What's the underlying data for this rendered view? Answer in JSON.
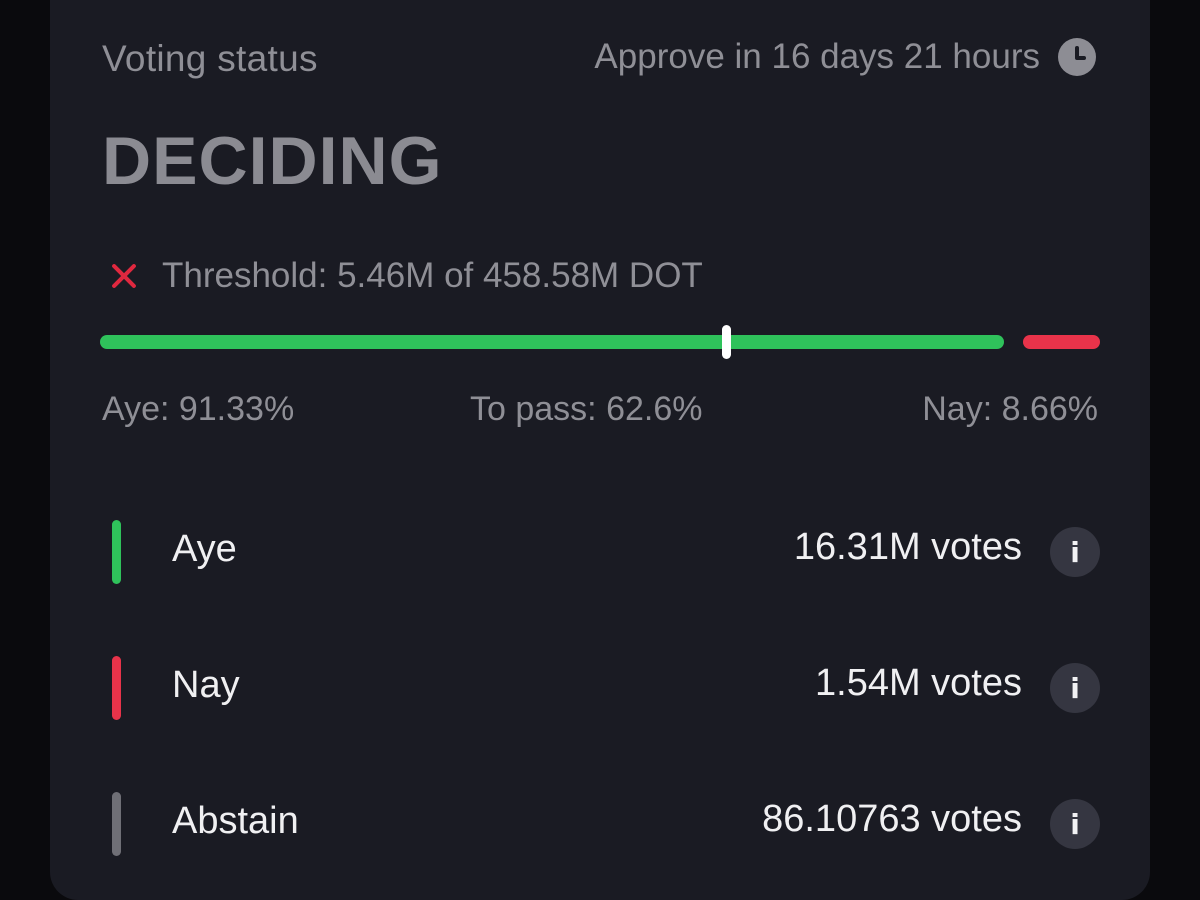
{
  "header": {
    "title": "Voting status",
    "approve_text": "Approve in 16 days 21 hours",
    "clock_icon": "clock-icon"
  },
  "status": "DECIDING",
  "threshold": {
    "text": "Threshold: 5.46M of 458.58M DOT",
    "icon": "x-icon",
    "met": false
  },
  "progress": {
    "aye_fraction": 0.9133,
    "nay_fraction": 0.0866,
    "pass_fraction": 0.626,
    "aye_label": "Aye: 91.33%",
    "pass_label": "To pass: 62.6%",
    "nay_label": "Nay: 8.66%"
  },
  "votes": [
    {
      "label": "Aye",
      "count": "16.31M votes",
      "color": "#2fc25b"
    },
    {
      "label": "Nay",
      "count": "1.54M votes",
      "color": "#e8334a"
    },
    {
      "label": "Abstain",
      "count": "86.10763 votes",
      "color": "#6f6f76"
    }
  ],
  "info_glyph": "i",
  "colors": {
    "card_bg": "#1a1b23",
    "aye": "#2fc25b",
    "nay": "#e8334a",
    "abstain": "#6f6f76",
    "threshold_x": "#e0283f"
  }
}
